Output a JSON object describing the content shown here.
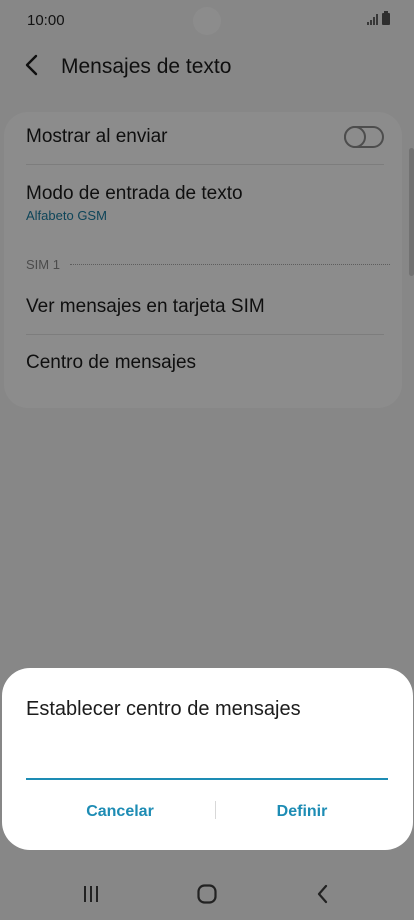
{
  "status": {
    "time": "10:00"
  },
  "header": {
    "title": "Mensajes de texto"
  },
  "settings": {
    "show_on_send": {
      "label": "Mostrar al enviar",
      "enabled": false
    },
    "input_mode": {
      "label": "Modo de entrada de texto",
      "value": "Alfabeto GSM"
    },
    "section": "SIM 1",
    "view_sim_messages": {
      "label": "Ver mensajes en tarjeta SIM"
    },
    "message_center": {
      "label": "Centro de mensajes"
    }
  },
  "dialog": {
    "title": "Establecer centro de mensajes",
    "input_value": "",
    "cancel_label": "Cancelar",
    "define_label": "Definir"
  },
  "colors": {
    "accent": "#1d8cb4",
    "subtitle": "#1a7ea3"
  },
  "icons": {
    "back": "back-arrow-icon",
    "recent_apps": "recent-apps-icon",
    "home": "home-icon",
    "nav_back": "back-chevron-icon"
  }
}
